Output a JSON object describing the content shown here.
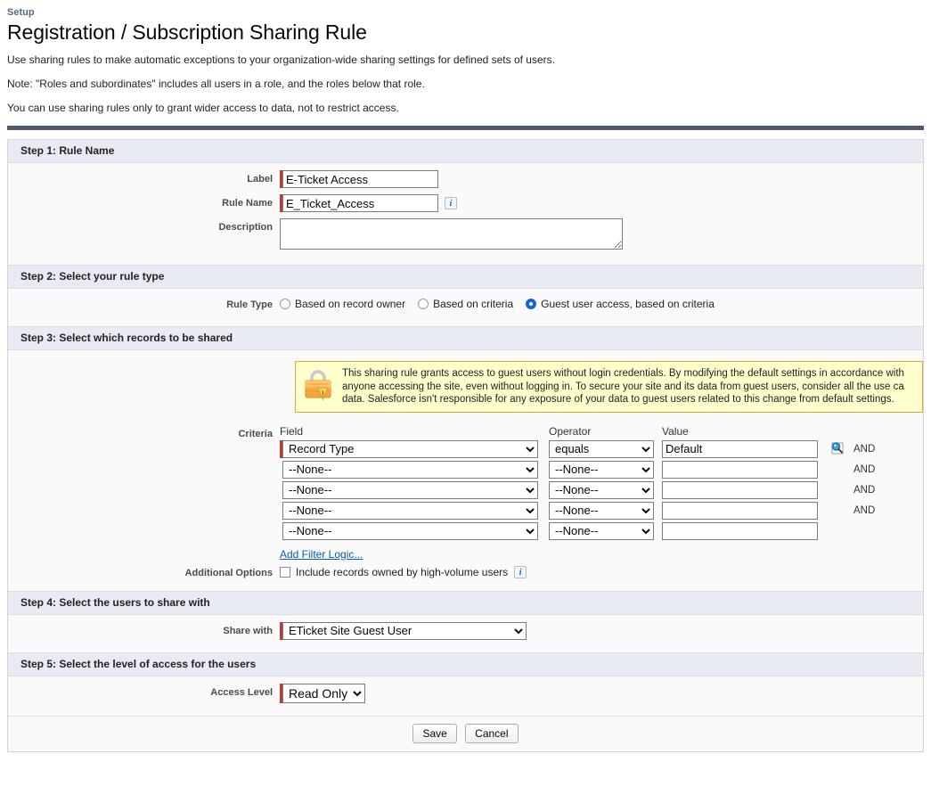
{
  "header": {
    "setup_label": "Setup",
    "title": "Registration / Subscription Sharing Rule",
    "intro_lines": [
      "Use sharing rules to make automatic exceptions to your organization-wide sharing settings for defined sets of users.",
      "Note: \"Roles and subordinates\" includes all users in a role, and the roles below that role.",
      "You can use sharing rules only to grant wider access to data, not to restrict access."
    ]
  },
  "step1": {
    "heading": "Step 1: Rule Name",
    "label_field_label": "Label",
    "label_value": "E-Ticket Access",
    "rule_name_label": "Rule Name",
    "rule_name_value": "E_Ticket_Access",
    "rule_name_info": "i",
    "description_label": "Description",
    "description_value": ""
  },
  "step2": {
    "heading": "Step 2: Select your rule type",
    "rule_type_label": "Rule Type",
    "options": [
      {
        "label": "Based on record owner",
        "selected": false
      },
      {
        "label": "Based on criteria",
        "selected": false
      },
      {
        "label": "Guest user access, based on criteria",
        "selected": true
      }
    ]
  },
  "step3": {
    "heading": "Step 3: Select which records to be shared",
    "warning": "This sharing rule grants access to guest users without login credentials. By modifying the default settings in accordance with anyone accessing the site, even without logging in. To secure your site and its data from guest users, consider all the use ca data. Salesforce isn't responsible for any exposure of your data to guest users related to this change from default settings.",
    "criteria_label": "Criteria",
    "col_field": "Field",
    "col_operator": "Operator",
    "col_value": "Value",
    "and_label": "AND",
    "rows": [
      {
        "field": "Record Type",
        "operator": "equals",
        "value": "Default",
        "required": true,
        "lookup": true,
        "and": true
      },
      {
        "field": "--None--",
        "operator": "--None--",
        "value": "",
        "required": false,
        "lookup": false,
        "and": true
      },
      {
        "field": "--None--",
        "operator": "--None--",
        "value": "",
        "required": false,
        "lookup": false,
        "and": true
      },
      {
        "field": "--None--",
        "operator": "--None--",
        "value": "",
        "required": false,
        "lookup": false,
        "and": true
      },
      {
        "field": "--None--",
        "operator": "--None--",
        "value": "",
        "required": false,
        "lookup": false,
        "and": false
      }
    ],
    "add_filter_logic": "Add Filter Logic...",
    "additional_options_label": "Additional Options",
    "high_volume_checkbox_label": "Include records owned by high-volume users",
    "high_volume_checked": false,
    "high_volume_info": "i"
  },
  "step4": {
    "heading": "Step 4: Select the users to share with",
    "share_with_label": "Share with",
    "share_with_value": "ETicket Site Guest User"
  },
  "step5": {
    "heading": "Step 5: Select the level of access for the users",
    "access_level_label": "Access Level",
    "access_level_value": "Read Only"
  },
  "footer": {
    "save_label": "Save",
    "cancel_label": "Cancel"
  },
  "colors": {
    "required_marker": "#c23934",
    "radio_selected": "#1565d8",
    "warning_bg": "#ffffcc",
    "warning_border": "#e8a33d",
    "section_header_bg": "#e8ebf3",
    "top_rule": "#4e5a72",
    "link": "#0b5cab"
  }
}
